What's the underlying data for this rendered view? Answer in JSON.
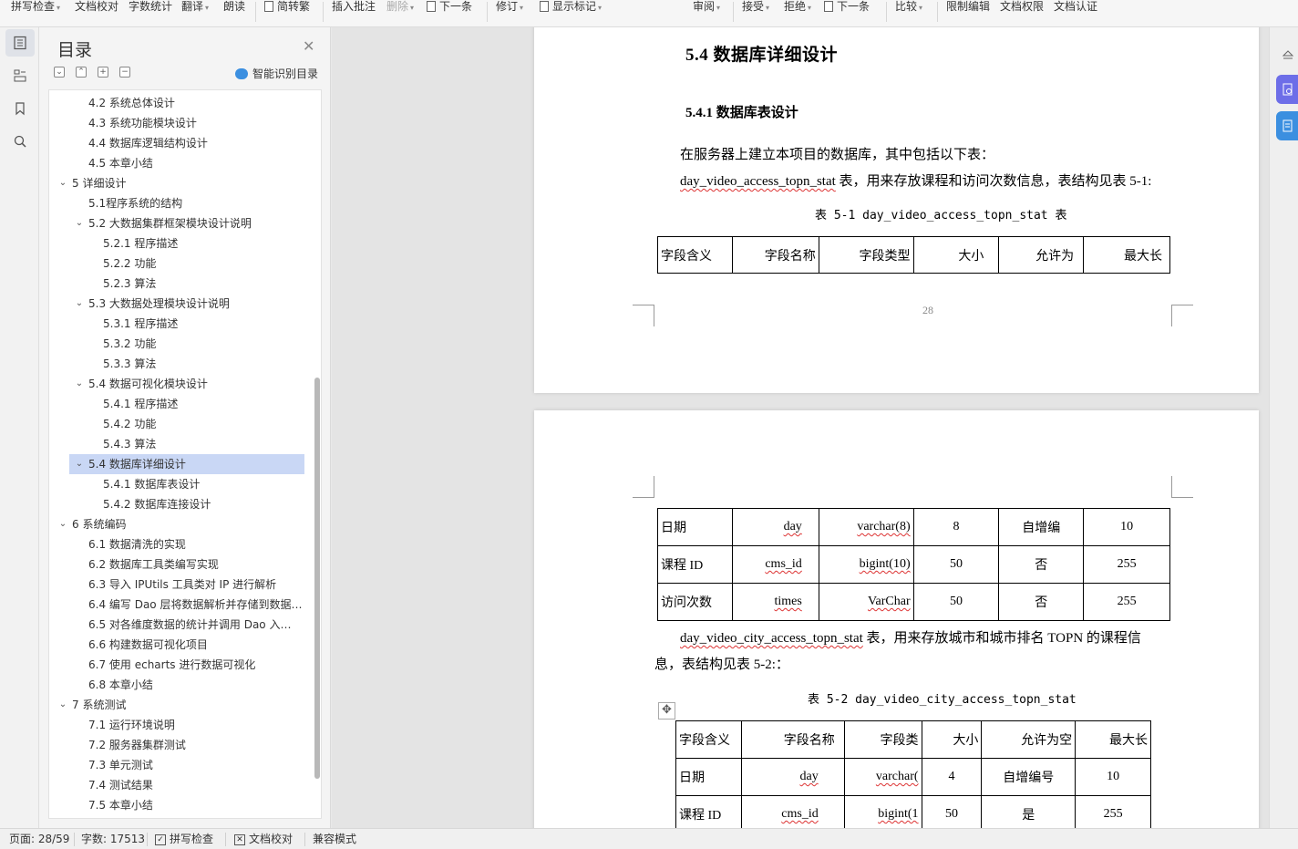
{
  "toolbar": {
    "items": [
      {
        "label": "拼写检查",
        "caret": true
      },
      {
        "label": "文档校对"
      },
      {
        "label": "字数统计"
      },
      {
        "label": "翻译",
        "caret": true
      },
      {
        "label": "朗读"
      },
      {
        "label": "简转繁"
      },
      {
        "label": "插入批注"
      },
      {
        "label": "删除",
        "caret": true
      },
      {
        "label": "下一条"
      },
      {
        "label": "修订",
        "caret": true
      },
      {
        "label": "显示标记",
        "caret": true
      },
      {
        "label": "审阅",
        "caret": true
      },
      {
        "label": "接受",
        "caret": true
      },
      {
        "label": "拒绝",
        "caret": true
      },
      {
        "label": "下一条"
      },
      {
        "label": "比较",
        "caret": true
      },
      {
        "label": "限制编辑"
      },
      {
        "label": "文档权限"
      },
      {
        "label": "文档认证"
      }
    ]
  },
  "toc": {
    "title": "目录",
    "smart_label": "智能识别目录",
    "items": [
      {
        "text": "4.2  系统总体设计",
        "level": 2
      },
      {
        "text": "4.3  系统功能模块设计",
        "level": 2
      },
      {
        "text": "4.4  数据库逻辑结构设计",
        "level": 2
      },
      {
        "text": "4.5  本章小结",
        "level": 2
      },
      {
        "text": "5    详细设计",
        "level": 1,
        "toggle": "v"
      },
      {
        "text": "5.1程序系统的结构",
        "level": 2
      },
      {
        "text": "5.2    大数据集群框架模块设计说明",
        "level": 2,
        "toggle": "v"
      },
      {
        "text": "5.2.1  程序描述",
        "level": 3
      },
      {
        "text": "5.2.2  功能",
        "level": 3
      },
      {
        "text": "5.2.3  算法",
        "level": 3
      },
      {
        "text": "5.3    大数据处理模块设计说明",
        "level": 2,
        "toggle": "v"
      },
      {
        "text": "5.3.1  程序描述",
        "level": 3
      },
      {
        "text": "5.3.2  功能",
        "level": 3
      },
      {
        "text": "5.3.3  算法",
        "level": 3
      },
      {
        "text": "5.4    数据可视化模块设计",
        "level": 2,
        "toggle": "v"
      },
      {
        "text": "5.4.1  程序描述",
        "level": 3
      },
      {
        "text": "5.4.2  功能",
        "level": 3
      },
      {
        "text": "5.4.3  算法",
        "level": 3
      },
      {
        "text": "5.4    数据库详细设计",
        "level": 2,
        "toggle": "v",
        "selected": true
      },
      {
        "text": "5.4.1  数据库表设计",
        "level": 3
      },
      {
        "text": "5.4.2  数据库连接设计",
        "level": 3
      },
      {
        "text": "6    系统编码",
        "level": 1,
        "toggle": "v"
      },
      {
        "text": "6.1  数据清洗的实现",
        "level": 2
      },
      {
        "text": "6.2  数据库工具类编写实现",
        "level": 2
      },
      {
        "text": "6.3 导入 IPUtils 工具类对 IP 进行解析",
        "level": 2
      },
      {
        "text": "6.4 编写 Dao 层将数据解析并存储到数据…",
        "level": 2
      },
      {
        "text": "6.5  对各维度数据的统计并调用 Dao 入…",
        "level": 2
      },
      {
        "text": "6.6  构建数据可视化项目",
        "level": 2
      },
      {
        "text": "6.7  使用 echarts 进行数据可视化",
        "level": 2
      },
      {
        "text": "6.8  本章小结",
        "level": 2
      },
      {
        "text": "7    系统测试",
        "level": 1,
        "toggle": "v"
      },
      {
        "text": "7.1  运行环境说明",
        "level": 2
      },
      {
        "text": "7.2  服务器集群测试",
        "level": 2
      },
      {
        "text": "7.3  单元测试",
        "level": 2
      },
      {
        "text": "7.4  测试结果",
        "level": 2
      },
      {
        "text": "7.5  本章小结",
        "level": 2
      }
    ]
  },
  "page1": {
    "h2": "5.4    数据库详细设计",
    "h3": "5.4.1  数据库表设计",
    "p1": "在服务器上建立本项目的数据库，其中包括以下表：",
    "p2_code": "day_video_access_topn_stat",
    "p2_rest": " 表，用来存放课程和访问次数信息，表结构见表 5-1:",
    "caption": "表 5-1 day_video_access_topn_stat 表",
    "headers": [
      "字段含义",
      "字段名称",
      "字段类型",
      "大小",
      "允许为",
      "最大长"
    ],
    "page_number": "28"
  },
  "page2": {
    "rows": [
      [
        "日期",
        "day",
        "varchar(8)",
        "8",
        "自增编",
        "10"
      ],
      [
        "课程 ID",
        "cms_id",
        "bigint(10)",
        "50",
        "否",
        "255"
      ],
      [
        "访问次数",
        "times",
        "VarChar",
        "50",
        "否",
        "255"
      ]
    ],
    "p3_code": "day_video_city_access_topn_stat",
    "p3_rest": " 表，用来存放城市和城市排名 TOPN 的课程信",
    "p3_line2": "息，表结构见表 5-2:：",
    "caption2": "表 5-2 day_video_city_access_topn_stat",
    "headers2": [
      "字段含义",
      "字段名称",
      "字段类",
      "大小",
      "允许为空",
      "最大长"
    ],
    "rows2": [
      [
        "日期",
        "day",
        "varchar(",
        "4",
        "自增编号",
        "10"
      ],
      [
        "课程 ID",
        "cms_id",
        "bigint(1",
        "50",
        "是",
        "255"
      ]
    ]
  },
  "status": {
    "page": "页面: 28/59",
    "words": "字数: 17513",
    "spell": "拼写检查",
    "proof": "文档校对",
    "compat": "兼容模式"
  },
  "colors": {
    "accent": "#3b7be0",
    "selection": "#c9d7f5"
  }
}
